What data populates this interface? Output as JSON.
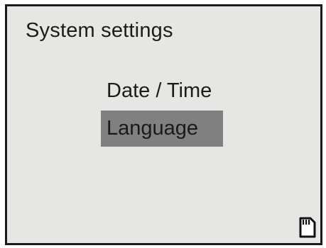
{
  "screen": {
    "title": "System settings",
    "menu": {
      "items": [
        {
          "label": "Date / Time",
          "selected": false
        },
        {
          "label": "Language",
          "selected": true
        }
      ]
    },
    "status": {
      "storage_icon": "sd-card-icon"
    }
  },
  "colors": {
    "background": "#e6e6e5",
    "selection": "#808080",
    "text": "#1c1c1c",
    "border": "#1a1a1a"
  }
}
